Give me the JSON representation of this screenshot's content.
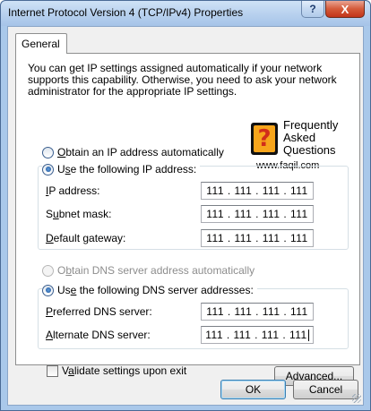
{
  "window": {
    "title": "Internet Protocol Version 4 (TCP/IPv4) Properties",
    "help_label": "?",
    "close_label": "X"
  },
  "tabs": [
    {
      "label": "General"
    }
  ],
  "info_text": "You can get IP settings assigned automatically if your network supports this capability. Otherwise, you need to ask your network administrator for the appropriate IP settings.",
  "watermark": {
    "badge": "?",
    "text": "Frequently\nAsked\nQuestions",
    "url": "www.faqil.com"
  },
  "ip_section": {
    "auto_option": {
      "underlined": "O",
      "rest": "btain an IP address automatically",
      "selected": false
    },
    "manual_option": {
      "prefix": "U",
      "underlined": "s",
      "rest": "e the following IP address:",
      "selected": true
    },
    "fields": [
      {
        "underlined": "I",
        "rest": "P address:",
        "value": "111 . 111 . 111 . 111"
      },
      {
        "prefix": "S",
        "underlined": "u",
        "rest": "bnet mask:",
        "value": "111 . 111 . 111 . 111"
      },
      {
        "underlined": "D",
        "rest": "efault gateway:",
        "value": "111 . 111 . 111 . 111"
      }
    ]
  },
  "dns_section": {
    "auto_option": {
      "prefix": "O",
      "underlined": "b",
      "rest": "tain DNS server address automatically",
      "selected": false,
      "disabled": true
    },
    "manual_option": {
      "prefix": "Us",
      "underlined": "e",
      "rest": " the following DNS server addresses:",
      "selected": true
    },
    "fields": [
      {
        "underlined": "P",
        "rest": "referred DNS server:",
        "value": "111 . 111 . 111 . 111"
      },
      {
        "underlined": "A",
        "rest": "lternate DNS server:",
        "value": "111 . 111 . 111 . 111"
      }
    ]
  },
  "validate": {
    "prefix": "V",
    "underlined": "a",
    "rest": "lidate settings upon exit",
    "checked": false
  },
  "buttons": {
    "advanced": {
      "prefix": "Ad",
      "underlined": "v",
      "rest": "anced..."
    },
    "ok": "OK",
    "cancel": "Cancel"
  },
  "colors": {
    "title_gradient": "#b7d0ee",
    "close_red": "#c2351a",
    "accent_blue": "#1c4f93"
  }
}
